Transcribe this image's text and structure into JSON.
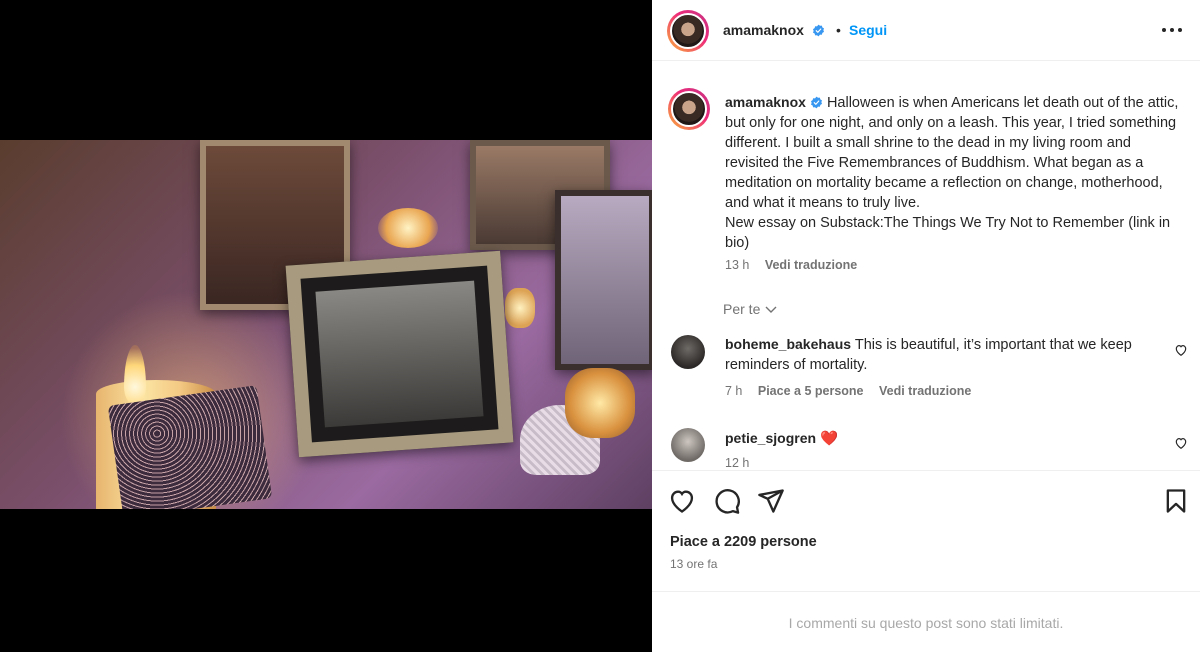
{
  "post": {
    "author": "amamaknox",
    "follow_label": "Segui",
    "separator": "•",
    "caption_text": "Halloween is when Americans let death out of the attic, but only for one night, and only on a leash. This year, I tried something different. I built a small shrine to the dead in my living room and revisited the Five Remembrances of Buddhism. What began as a meditation on mortality became a reflection on change, motherhood, and what it means to truly live.",
    "caption_line2": "New essay on Substack:The Things We Try Not to Remember (link in bio)",
    "caption_time": "13 h",
    "translate_label": "Vedi traduzione"
  },
  "filter": {
    "label": "Per te"
  },
  "comments": [
    {
      "user": "boheme_bakehaus",
      "text": "This is beautiful, it’s important that we keep reminders of mortality.",
      "time": "7 h",
      "likes_label": "Piace a 5 persone",
      "translate_label": "Vedi traduzione"
    },
    {
      "user": "petie_sjogren",
      "text": "❤️",
      "time": "12 h"
    }
  ],
  "stats": {
    "likes": "Piace a 2209 persone",
    "posted": "13 ore fa"
  },
  "footer": {
    "limited": "I commenti su questo post sono stati limitati."
  },
  "colors": {
    "accent": "#0095f6",
    "verified": "#3897f0",
    "text": "#262626",
    "muted": "#737373"
  }
}
